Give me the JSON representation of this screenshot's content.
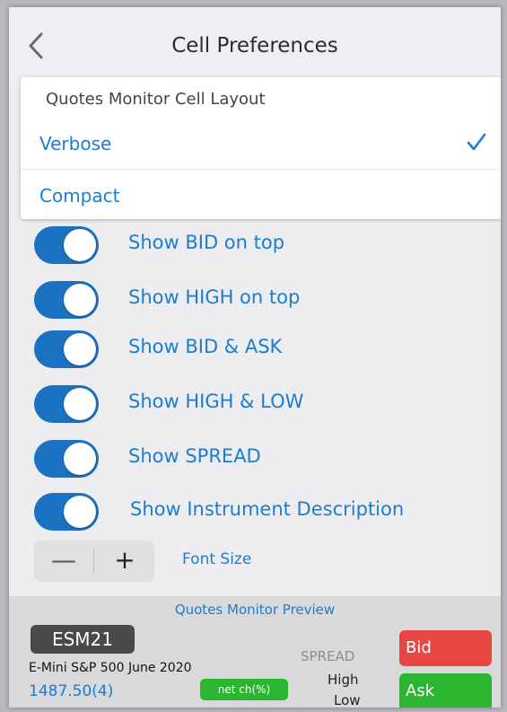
{
  "header": {
    "title": "Cell Preferences",
    "back_icon": "chevron-left-icon"
  },
  "layout_menu": {
    "header": "Quotes Monitor Cell Layout",
    "options": [
      {
        "label": "Verbose",
        "selected": true
      },
      {
        "label": "Compact",
        "selected": false
      }
    ],
    "check_icon": "checkmark-icon"
  },
  "toggles": [
    {
      "label": "Show BID on top",
      "on": true
    },
    {
      "label": "Show HIGH on top",
      "on": true
    },
    {
      "label": "Show BID & ASK",
      "on": true
    },
    {
      "label": "Show HIGH & LOW",
      "on": true
    },
    {
      "label": "Show SPREAD",
      "on": true
    },
    {
      "label": "Show Instrument Description",
      "on": true
    }
  ],
  "font_size": {
    "label": "Font Size",
    "minus": "—",
    "plus": "+"
  },
  "preview": {
    "title": "Quotes Monitor Preview",
    "symbol": "ESM21",
    "description": "E-Mini S&P 500 June 2020",
    "price": "1487.50(4)",
    "net_change": "net ch(%)",
    "spread": "SPREAD",
    "high": "High",
    "low": "Low",
    "bid": "Bid",
    "ask": "Ask"
  },
  "colors": {
    "accent": "#1c7cd0",
    "switch_on": "#1c72c2",
    "bid": "#e74740",
    "ask": "#2bb62f"
  }
}
